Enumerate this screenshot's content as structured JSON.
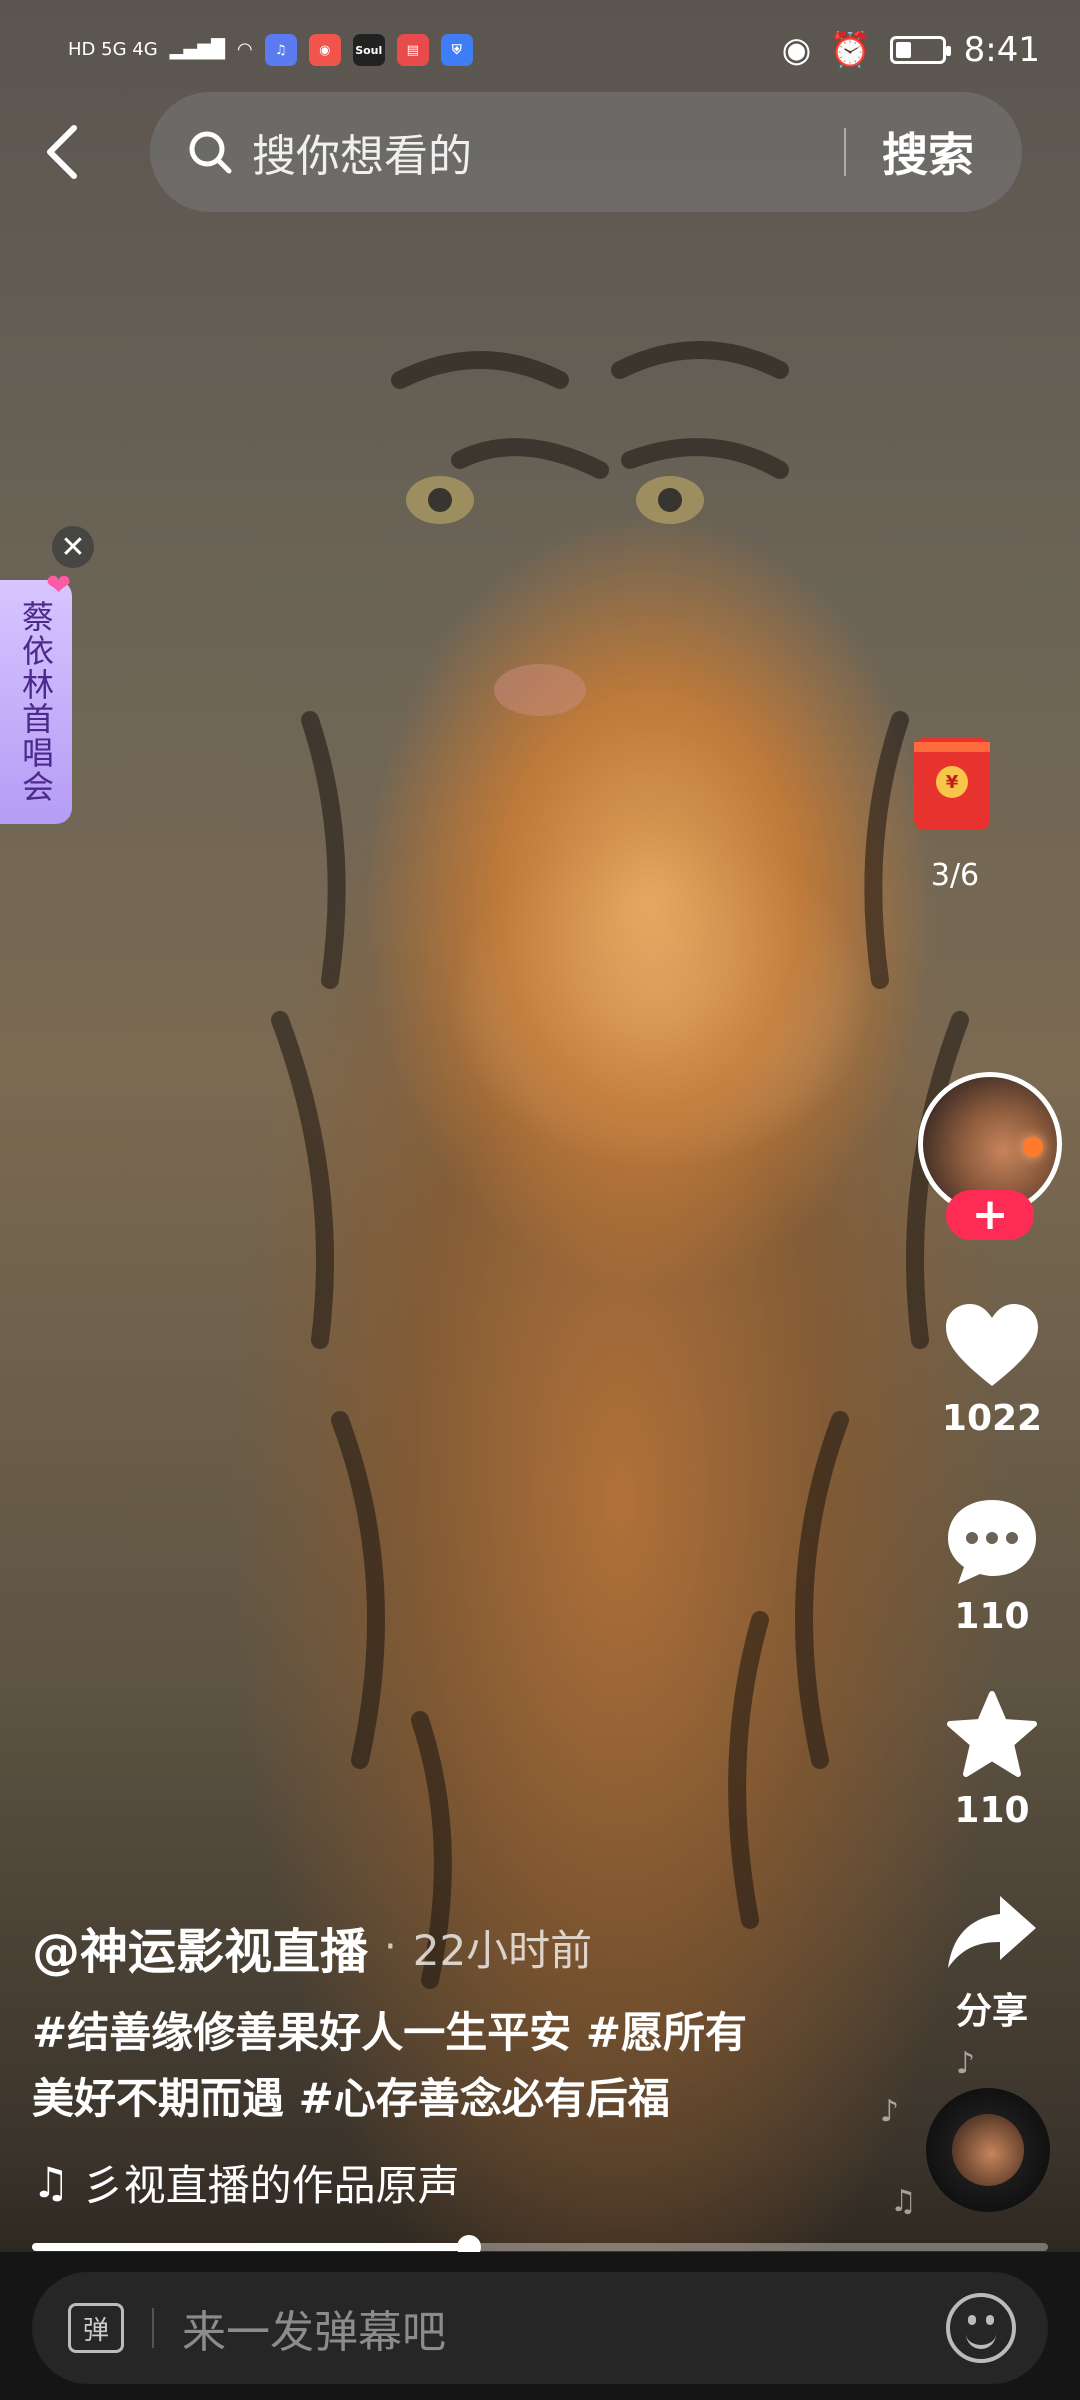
{
  "status_bar": {
    "time": "8:41",
    "left_network": "HD 5G 4G",
    "app_icons": [
      "music-app-icon",
      "group-app-icon",
      "soul-app-icon",
      "book-app-icon",
      "shield-app-icon"
    ],
    "soul_label": "Soul"
  },
  "search": {
    "placeholder": "搜你想看的",
    "button": "搜索"
  },
  "side_tag": {
    "label": "蔡依林首唱会"
  },
  "red_packet": {
    "count": "3/6",
    "coin_symbol": "¥"
  },
  "actions": {
    "likes": "1022",
    "comments": "110",
    "favorites": "110",
    "share": "分享"
  },
  "video": {
    "author": "@神运影视直播",
    "time_separator": "·",
    "posted": "22小时前",
    "caption": "#结善缘修善果好人一生平安 #愿所有美好不期而遇 #心存善念必有后福",
    "music": "彡视直播的作品原声",
    "progress": 0.43
  },
  "bottom_bar": {
    "danmu_icon_text": "弹",
    "placeholder": "来一发弹幕吧"
  },
  "colors": {
    "accent": "#fe2c55",
    "red_packet": "#e8322e",
    "tag_bg": "#c8b3fb"
  }
}
